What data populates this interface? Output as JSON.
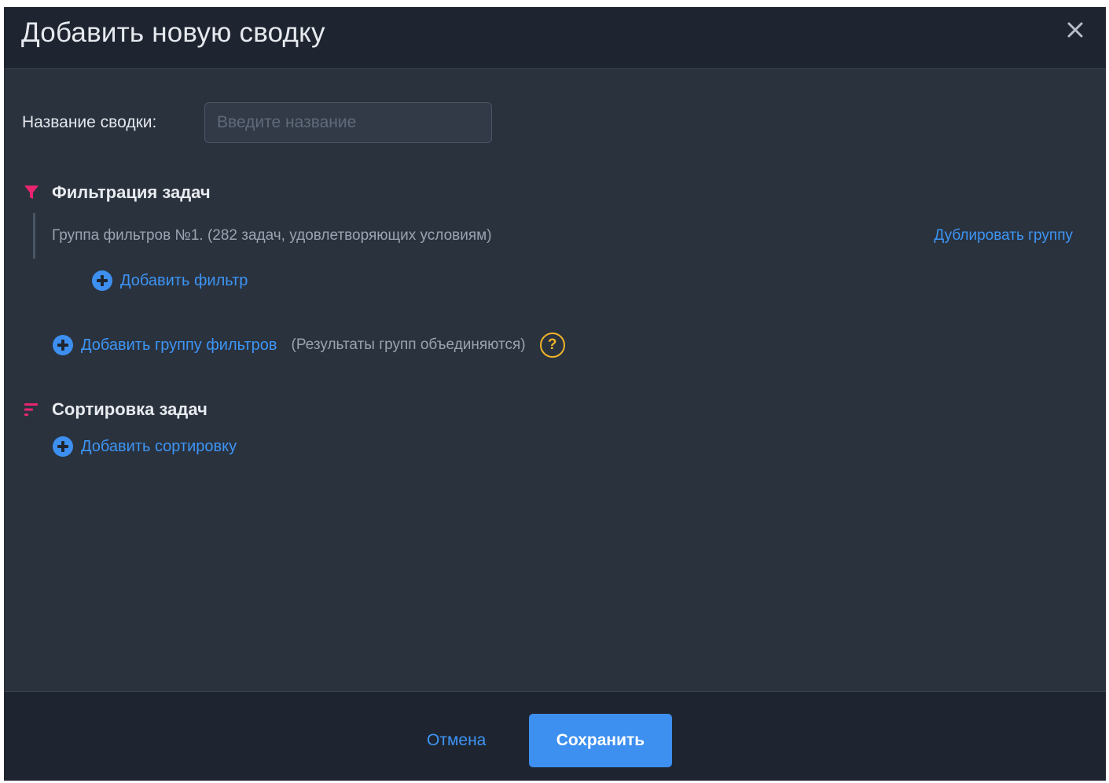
{
  "dialog": {
    "title": "Добавить новую сводку",
    "close_icon": "close-icon"
  },
  "name_field": {
    "label": "Название сводки:",
    "value": "",
    "placeholder": "Введите название"
  },
  "filtering": {
    "title": "Фильтрация задач",
    "icon": "funnel-icon",
    "icon_color": "#e8256e",
    "groups": [
      {
        "label": "Группа фильтров №1. (282 задач, удовлетворяющих условиям)",
        "duplicate_label": "Дублировать группу",
        "add_filter_label": "Добавить фильтр"
      }
    ],
    "add_group_label": "Добавить группу фильтров",
    "add_group_hint": "(Результаты групп объединяются)",
    "help_icon": "question-icon",
    "help_glyph": "?"
  },
  "sorting": {
    "title": "Сортировка задач",
    "icon": "sort-icon",
    "add_sort_label": "Добавить сортировку"
  },
  "footer": {
    "cancel_label": "Отмена",
    "save_label": "Сохранить"
  },
  "colors": {
    "accent": "#3d8ff0",
    "link": "#3d95f5",
    "warning": "#f0b429",
    "icon_accent": "#e8256e",
    "body_bg": "#2a323e",
    "header_bg": "#1f2530"
  }
}
